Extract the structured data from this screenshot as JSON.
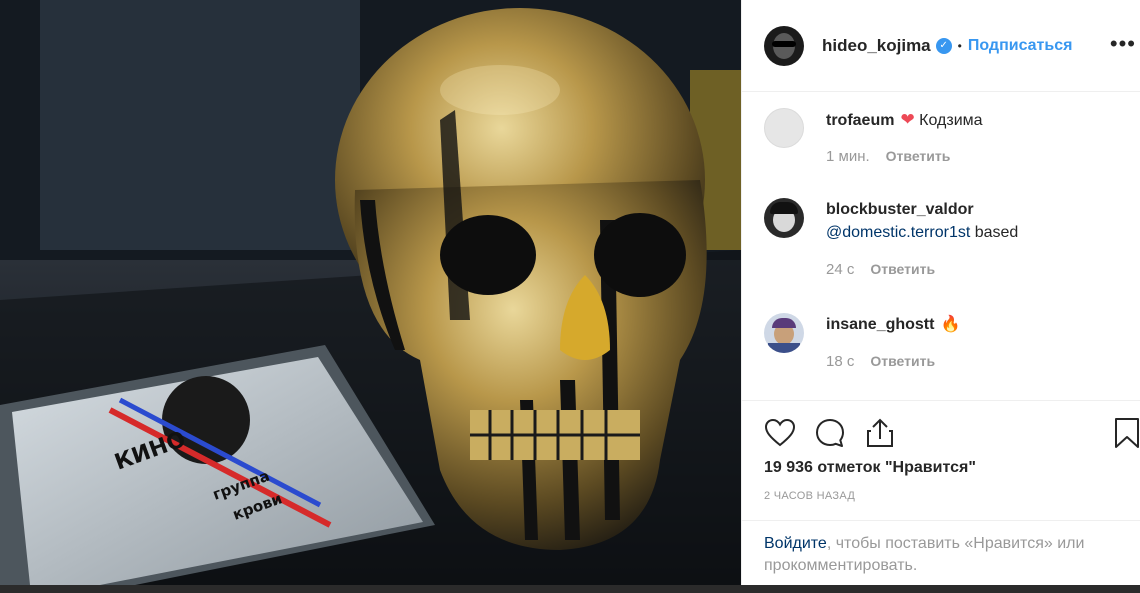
{
  "post": {
    "author": "hideo_kojima",
    "follow_label": "Подписаться",
    "separator": "•",
    "more_label": "•••",
    "verified_mark": "✓"
  },
  "comments": [
    {
      "username": "trofaeum",
      "emoji": "❤",
      "text": "Кодзима",
      "time": "1 мин.",
      "reply_label": "Ответить"
    },
    {
      "username": "blockbuster_valdor",
      "mention": "@domestic.terror1st",
      "text": "based",
      "time": "24 с",
      "reply_label": "Ответить"
    },
    {
      "username": "insane_ghostt",
      "emoji": "🔥",
      "time": "18 с",
      "reply_label": "Ответить"
    }
  ],
  "actions": {
    "like_icon": "heart-outline-icon",
    "comment_icon": "comment-bubble-icon",
    "share_icon": "share-icon",
    "save_icon": "bookmark-icon"
  },
  "likes_text": "19 936 отметок \"Нравится\"",
  "posted_time": "2 ЧАСОВ НАЗАД",
  "login_prompt": {
    "link": "Войдите",
    "rest": ", чтобы поставить «Нравится» или прокомментировать."
  },
  "photo": {
    "album_artist": "КИНО",
    "album_title_1": "группа",
    "album_title_2": "крови"
  },
  "colors": {
    "accent": "#3897f0",
    "link_dark": "#003569",
    "heart": "#ed4956"
  }
}
